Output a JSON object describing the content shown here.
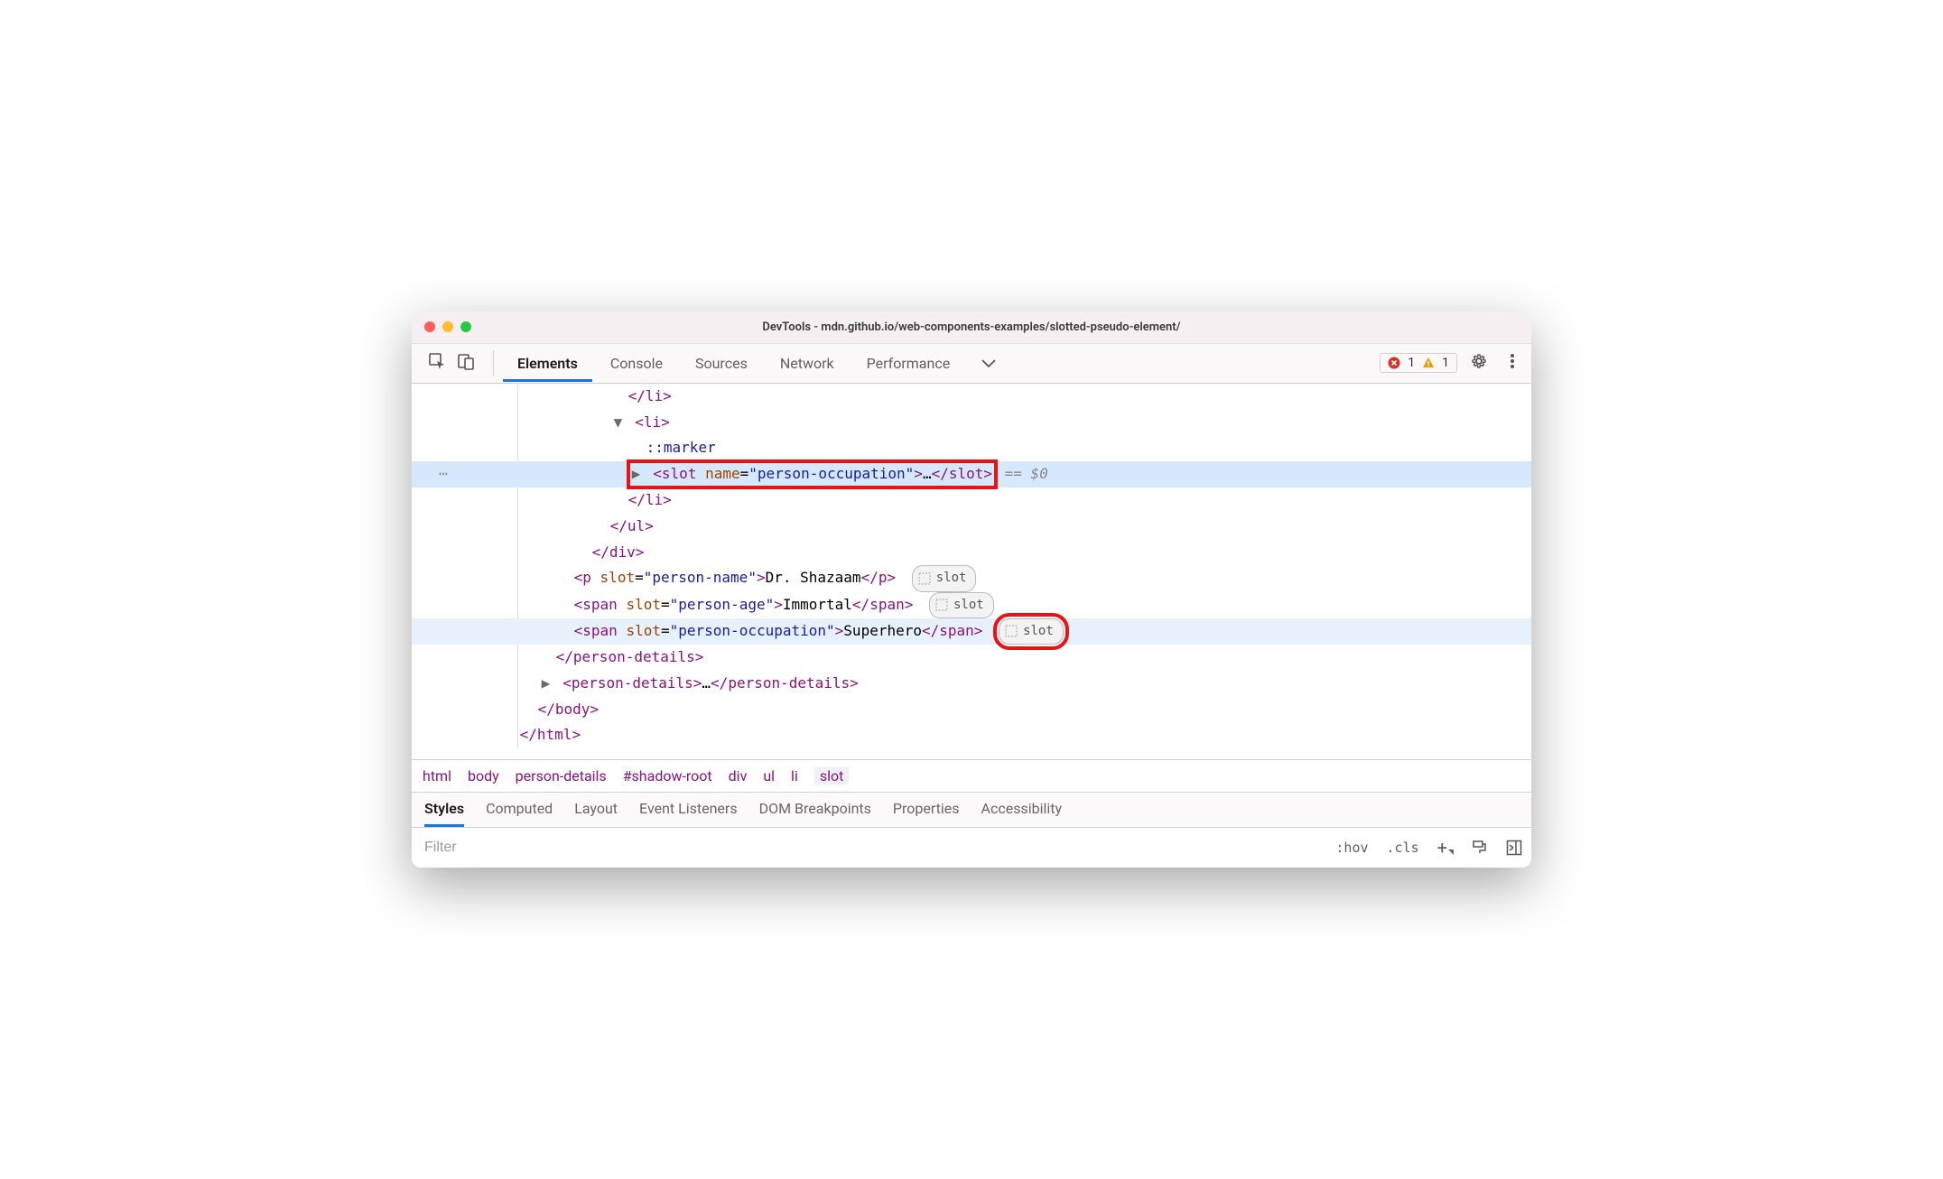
{
  "title": "DevTools - mdn.github.io/web-components-examples/slotted-pseudo-element/",
  "tabs": [
    "Elements",
    "Console",
    "Sources",
    "Network",
    "Performance"
  ],
  "activeTab": 0,
  "status": {
    "errors": "1",
    "warnings": "1"
  },
  "tree": {
    "liClose1": "</li>",
    "liOpen": "<li>",
    "marker": "::marker",
    "slot": {
      "open": "<slot",
      "attr": "name",
      "val": "\"person-occupation\"",
      "mid": ">…",
      "close": "</slot>",
      "suffix": " == $0"
    },
    "liClose2": "</li>",
    "ulClose": "</ul>",
    "divClose": "</div>",
    "pName": {
      "open": "<p",
      "attr": "slot",
      "val": "\"person-name\"",
      "text": "Dr. Shazaam",
      "close": "</p>"
    },
    "spanAge": {
      "open": "<span",
      "attr": "slot",
      "val": "\"person-age\"",
      "text": "Immortal",
      "close": "</span>"
    },
    "spanOcc": {
      "open": "<span",
      "attr": "slot",
      "val": "\"person-occupation\"",
      "text": "Superhero",
      "close": "</span>"
    },
    "pdClose": "</person-details>",
    "pd2": {
      "open": "<person-details>",
      "mid": "…",
      "close": "</person-details>"
    },
    "bodyClose": "</body>",
    "htmlClose": "</html>",
    "slotBadge": "slot",
    "ellipsis": "…"
  },
  "crumbs": [
    "html",
    "body",
    "person-details",
    "#shadow-root",
    "div",
    "ul",
    "li",
    "slot"
  ],
  "subtabs": [
    "Styles",
    "Computed",
    "Layout",
    "Event Listeners",
    "DOM Breakpoints",
    "Properties",
    "Accessibility"
  ],
  "activeSubtab": 0,
  "filterPlaceholder": "Filter",
  "tools": {
    "hov": ":hov",
    "cls": ".cls",
    "plus": "+"
  }
}
